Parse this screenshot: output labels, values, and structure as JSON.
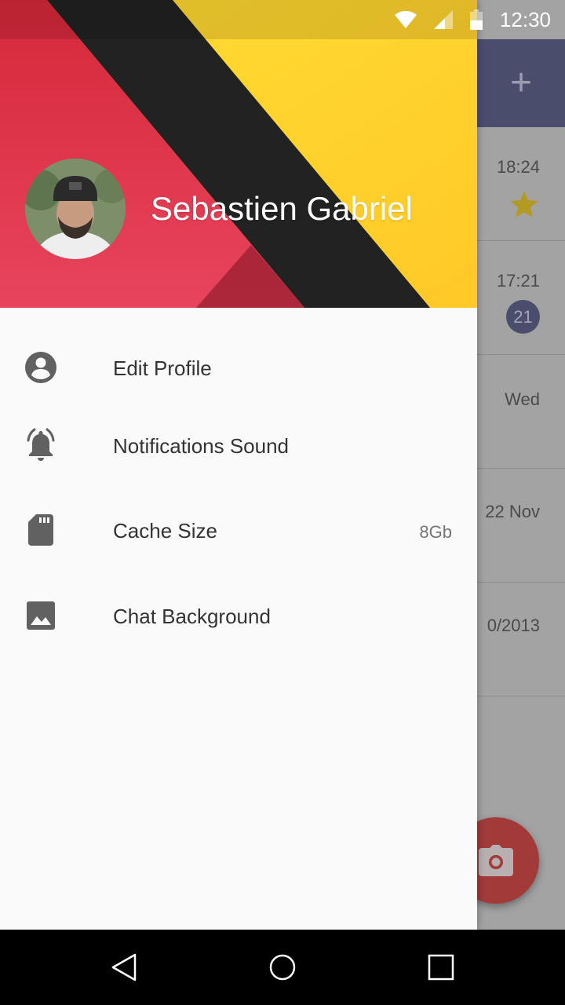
{
  "status_bar": {
    "time": "12:30",
    "icons": [
      "wifi-icon",
      "cell-signal-icon",
      "battery-icon"
    ]
  },
  "background_app": {
    "toolbar_color": "#4a4d6c",
    "action_icon": "add-icon",
    "rows": [
      {
        "time": "18:24",
        "indicator": "star-icon"
      },
      {
        "time": "17:21",
        "badge": "21"
      },
      {
        "time": "Wed"
      },
      {
        "time": "22 Nov"
      },
      {
        "time": "0/2013"
      }
    ],
    "fab_icon": "camera-icon",
    "fab_color": "#a33a3a"
  },
  "drawer": {
    "user_name": "Sebastien Gabriel",
    "header_colors": {
      "red": "#e23a4f",
      "black": "#222222",
      "yellow": "#ffd12e"
    },
    "menu": [
      {
        "icon": "account-circle-icon",
        "label": "Edit Profile",
        "value": ""
      },
      {
        "icon": "alarm-bell-icon",
        "label": "Notifications Sound",
        "value": ""
      },
      {
        "icon": "sd-card-icon",
        "label": "Cache Size",
        "value": "8Gb"
      },
      {
        "icon": "image-icon",
        "label": "Chat Background",
        "value": ""
      }
    ]
  },
  "nav_bar": {
    "buttons": [
      "back-icon",
      "home-icon",
      "recents-icon"
    ]
  }
}
